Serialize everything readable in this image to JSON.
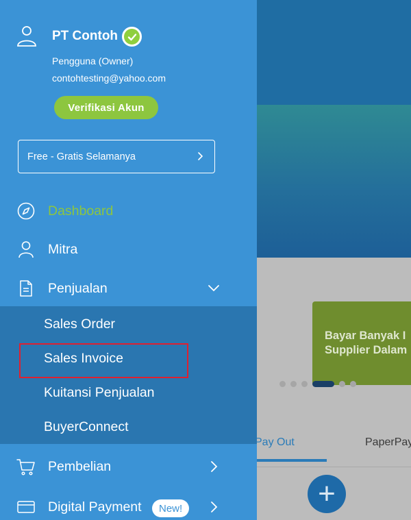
{
  "drawer": {
    "profile": {
      "company_name": "PT Contoh",
      "role": "Pengguna (Owner)",
      "email": "contohtesting@yahoo.com",
      "verify_button": "Verifikasi Akun"
    },
    "plan": {
      "label": "Free - Gratis Selamanya"
    },
    "menu": {
      "dashboard": "Dashboard",
      "mitra": "Mitra",
      "penjualan": "Penjualan",
      "pembelian": "Pembelian",
      "digital_payment": "Digital Payment",
      "digital_payment_badge": "New!"
    },
    "penjualan_submenu": [
      "Sales Order",
      "Sales Invoice",
      "Kuitansi Penjualan",
      "BuyerConnect"
    ]
  },
  "background": {
    "banner_card_text": [
      "Bayar Banyak I",
      "Supplier Dalam"
    ],
    "tabs": [
      "Pay Out",
      "PaperPay"
    ],
    "fab_symbol": "+"
  },
  "colors": {
    "drawer_bg": "#3b93d6",
    "submenu_bg": "#2a76b0",
    "accent_green": "#8dc63f",
    "highlight_red": "#e0202f",
    "tab_active": "#2a7bb8"
  },
  "icons": {
    "profile": "user-icon",
    "verified": "verified-check-icon",
    "dashboard": "compass-icon",
    "mitra": "person-icon",
    "penjualan": "document-icon",
    "pembelian": "cart-icon",
    "digital_payment": "card-icon"
  }
}
